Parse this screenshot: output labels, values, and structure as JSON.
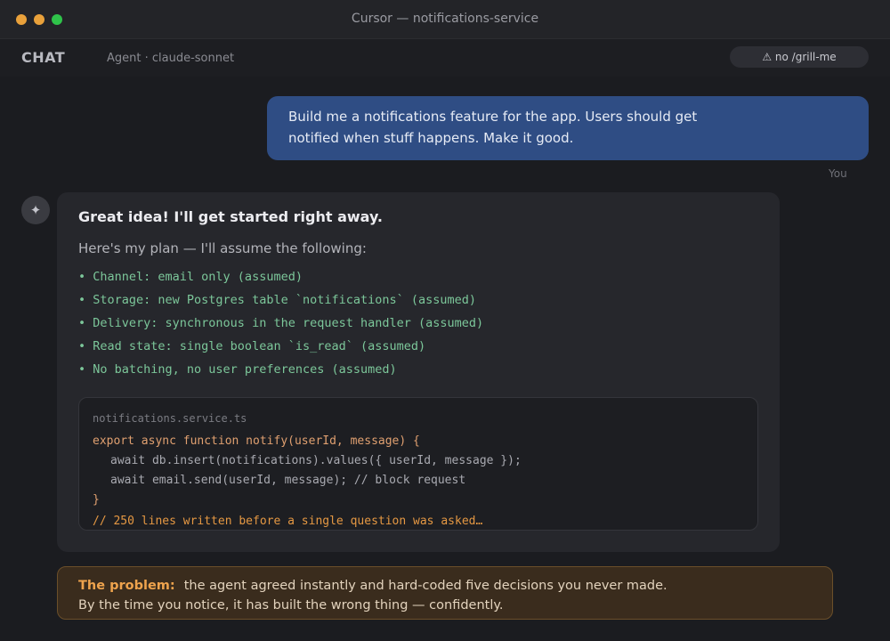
{
  "window": {
    "title": "Cursor — notifications-service"
  },
  "header": {
    "chat_label": "CHAT",
    "agent_label": "Agent · claude-sonnet",
    "badge": "⚠ no /grill-me"
  },
  "user_message": {
    "lines": [
      "Build me a notifications feature for the app. Users should get",
      "notified when stuff happens. Make it good."
    ],
    "sender": "You"
  },
  "agent_message": {
    "avatar_glyph": "✦",
    "title": "Great idea! I'll get started right away.",
    "intro": "Here's my plan — I'll assume the following:",
    "assumptions": [
      "• Channel: email only (assumed)",
      "• Storage: new Postgres table `notifications` (assumed)",
      "• Delivery: synchronous in the request handler (assumed)",
      "• Read state: single boolean `is_read` (assumed)",
      "• No batching, no user preferences (assumed)"
    ],
    "code": {
      "filename": "notifications.service.ts",
      "lines": [
        "export async function notify(userId, message) {",
        "await db.insert(notifications).values({ userId, message });",
        "await email.send(userId, message); // block request",
        "}",
        "// 250 lines written before a single question was asked…"
      ]
    }
  },
  "callout": {
    "label": "The problem:",
    "line1": "the agent agreed instantly and hard-coded five decisions you never made.",
    "line2": "By the time you notice, it has built the wrong thing — confidently."
  },
  "colors": {
    "user_bubble": "#2f4d84",
    "assumption_green": "#7cc79a",
    "warning_orange": "#eea34d",
    "traffic_close": "#e9a13b",
    "traffic_max": "#2fc34a"
  }
}
